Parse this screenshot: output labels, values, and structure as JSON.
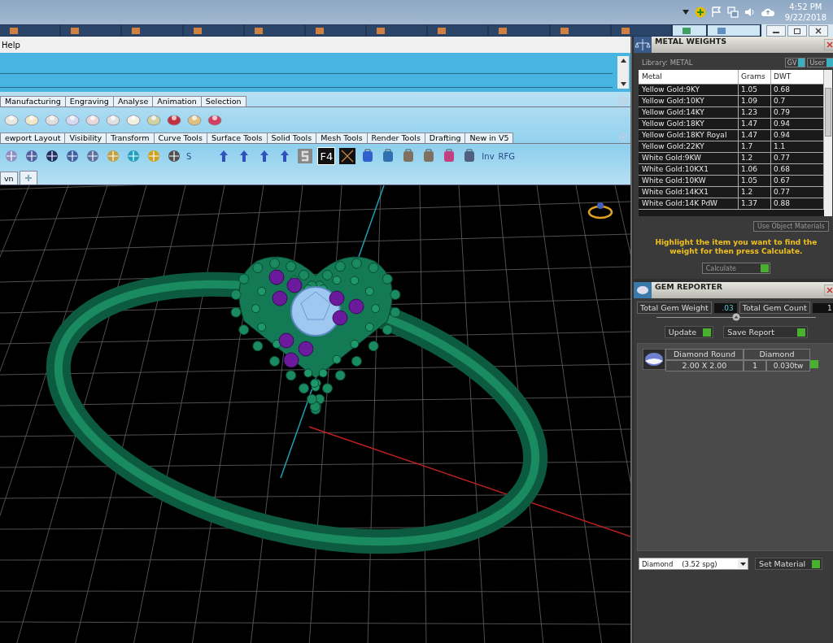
{
  "taskbar": {
    "time": "4:52 PM",
    "date": "9/22/2018"
  },
  "menu": [
    "Help"
  ],
  "ribbon_tabs": [
    "Manufacturing",
    "Engraving",
    "Analyse",
    "Animation",
    "Selection"
  ],
  "tool_tabs": [
    "ewport Layout",
    "Visibility",
    "Transform",
    "Curve Tools",
    "Surface Tools",
    "Solid Tools",
    "Mesh Tools",
    "Render Tools",
    "Drafting",
    "New in V5"
  ],
  "toolbar_labels": [
    "S",
    "F4",
    "Inv",
    "RFG"
  ],
  "document_tabs": [
    "vn"
  ],
  "metal_weights": {
    "title": "METAL WEIGHTS",
    "library": "Library: METAL",
    "toggles": [
      {
        "label": "GV",
        "on": true
      },
      {
        "label": "User",
        "on": true
      }
    ],
    "columns": [
      "Metal",
      "Grams",
      "DWT"
    ],
    "rows": [
      {
        "metal": "Yellow Gold:9KY",
        "grams": "1.05",
        "dwt": "0.68"
      },
      {
        "metal": "Yellow Gold:10KY",
        "grams": "1.09",
        "dwt": "0.7"
      },
      {
        "metal": "Yellow Gold:14KY",
        "grams": "1.23",
        "dwt": "0.79"
      },
      {
        "metal": "Yellow Gold:18KY",
        "grams": "1.47",
        "dwt": "0.94"
      },
      {
        "metal": "Yellow Gold:18KY Royal",
        "grams": "1.47",
        "dwt": "0.94"
      },
      {
        "metal": "Yellow Gold:22KY",
        "grams": "1.7",
        "dwt": "1.1"
      },
      {
        "metal": "White Gold:9KW",
        "grams": "1.2",
        "dwt": "0.77"
      },
      {
        "metal": "White Gold:10KX1",
        "grams": "1.06",
        "dwt": "0.68"
      },
      {
        "metal": "White Gold:10KW",
        "grams": "1.05",
        "dwt": "0.67"
      },
      {
        "metal": "White Gold:14KX1",
        "grams": "1.2",
        "dwt": "0.77"
      },
      {
        "metal": "White Gold:14K PdW",
        "grams": "1.37",
        "dwt": "0.88"
      }
    ],
    "use_object_materials": "Use Object Materials",
    "hint": "Highlight the item you want to find the weight for then press Calculate.",
    "calculate": "Calculate"
  },
  "gem_reporter": {
    "title": "GEM REPORTER",
    "weight_label": "Total Gem Weight",
    "weight": ".03",
    "count_label": "Total Gem Count",
    "count": "1",
    "update": "Update",
    "save_report": "Save Report",
    "gems": [
      {
        "shape": "Diamond Round",
        "material": "Diamond",
        "size": "2.00 X 2.00",
        "quantity": "1",
        "weight": "0.030tw"
      }
    ],
    "material": "Diamond    (3.52 spg)",
    "set_material": "Set Material"
  }
}
